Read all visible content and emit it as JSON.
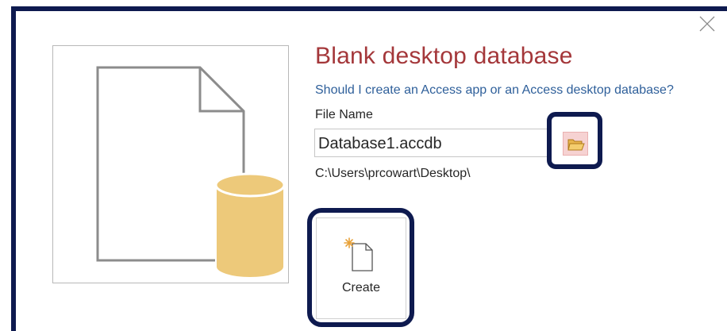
{
  "dialog": {
    "title": "Blank desktop database",
    "help_link": "Should I create an Access app or an Access desktop database?",
    "file_name_label": "File Name",
    "file_name_value": "Database1.accdb",
    "file_path": "C:\\Users\\prcowart\\Desktop\\",
    "create_label": "Create"
  },
  "icons": {
    "close": "close-icon",
    "preview": "blank-database-icon",
    "browse": "folder-icon",
    "create": "new-document-icon"
  },
  "colors": {
    "title": "#a4373a",
    "link": "#2e5f9a",
    "highlight_border": "#0e1a4f",
    "database_cylinder": "#edc97a",
    "browse_button_bg": "#f6d2d2"
  }
}
